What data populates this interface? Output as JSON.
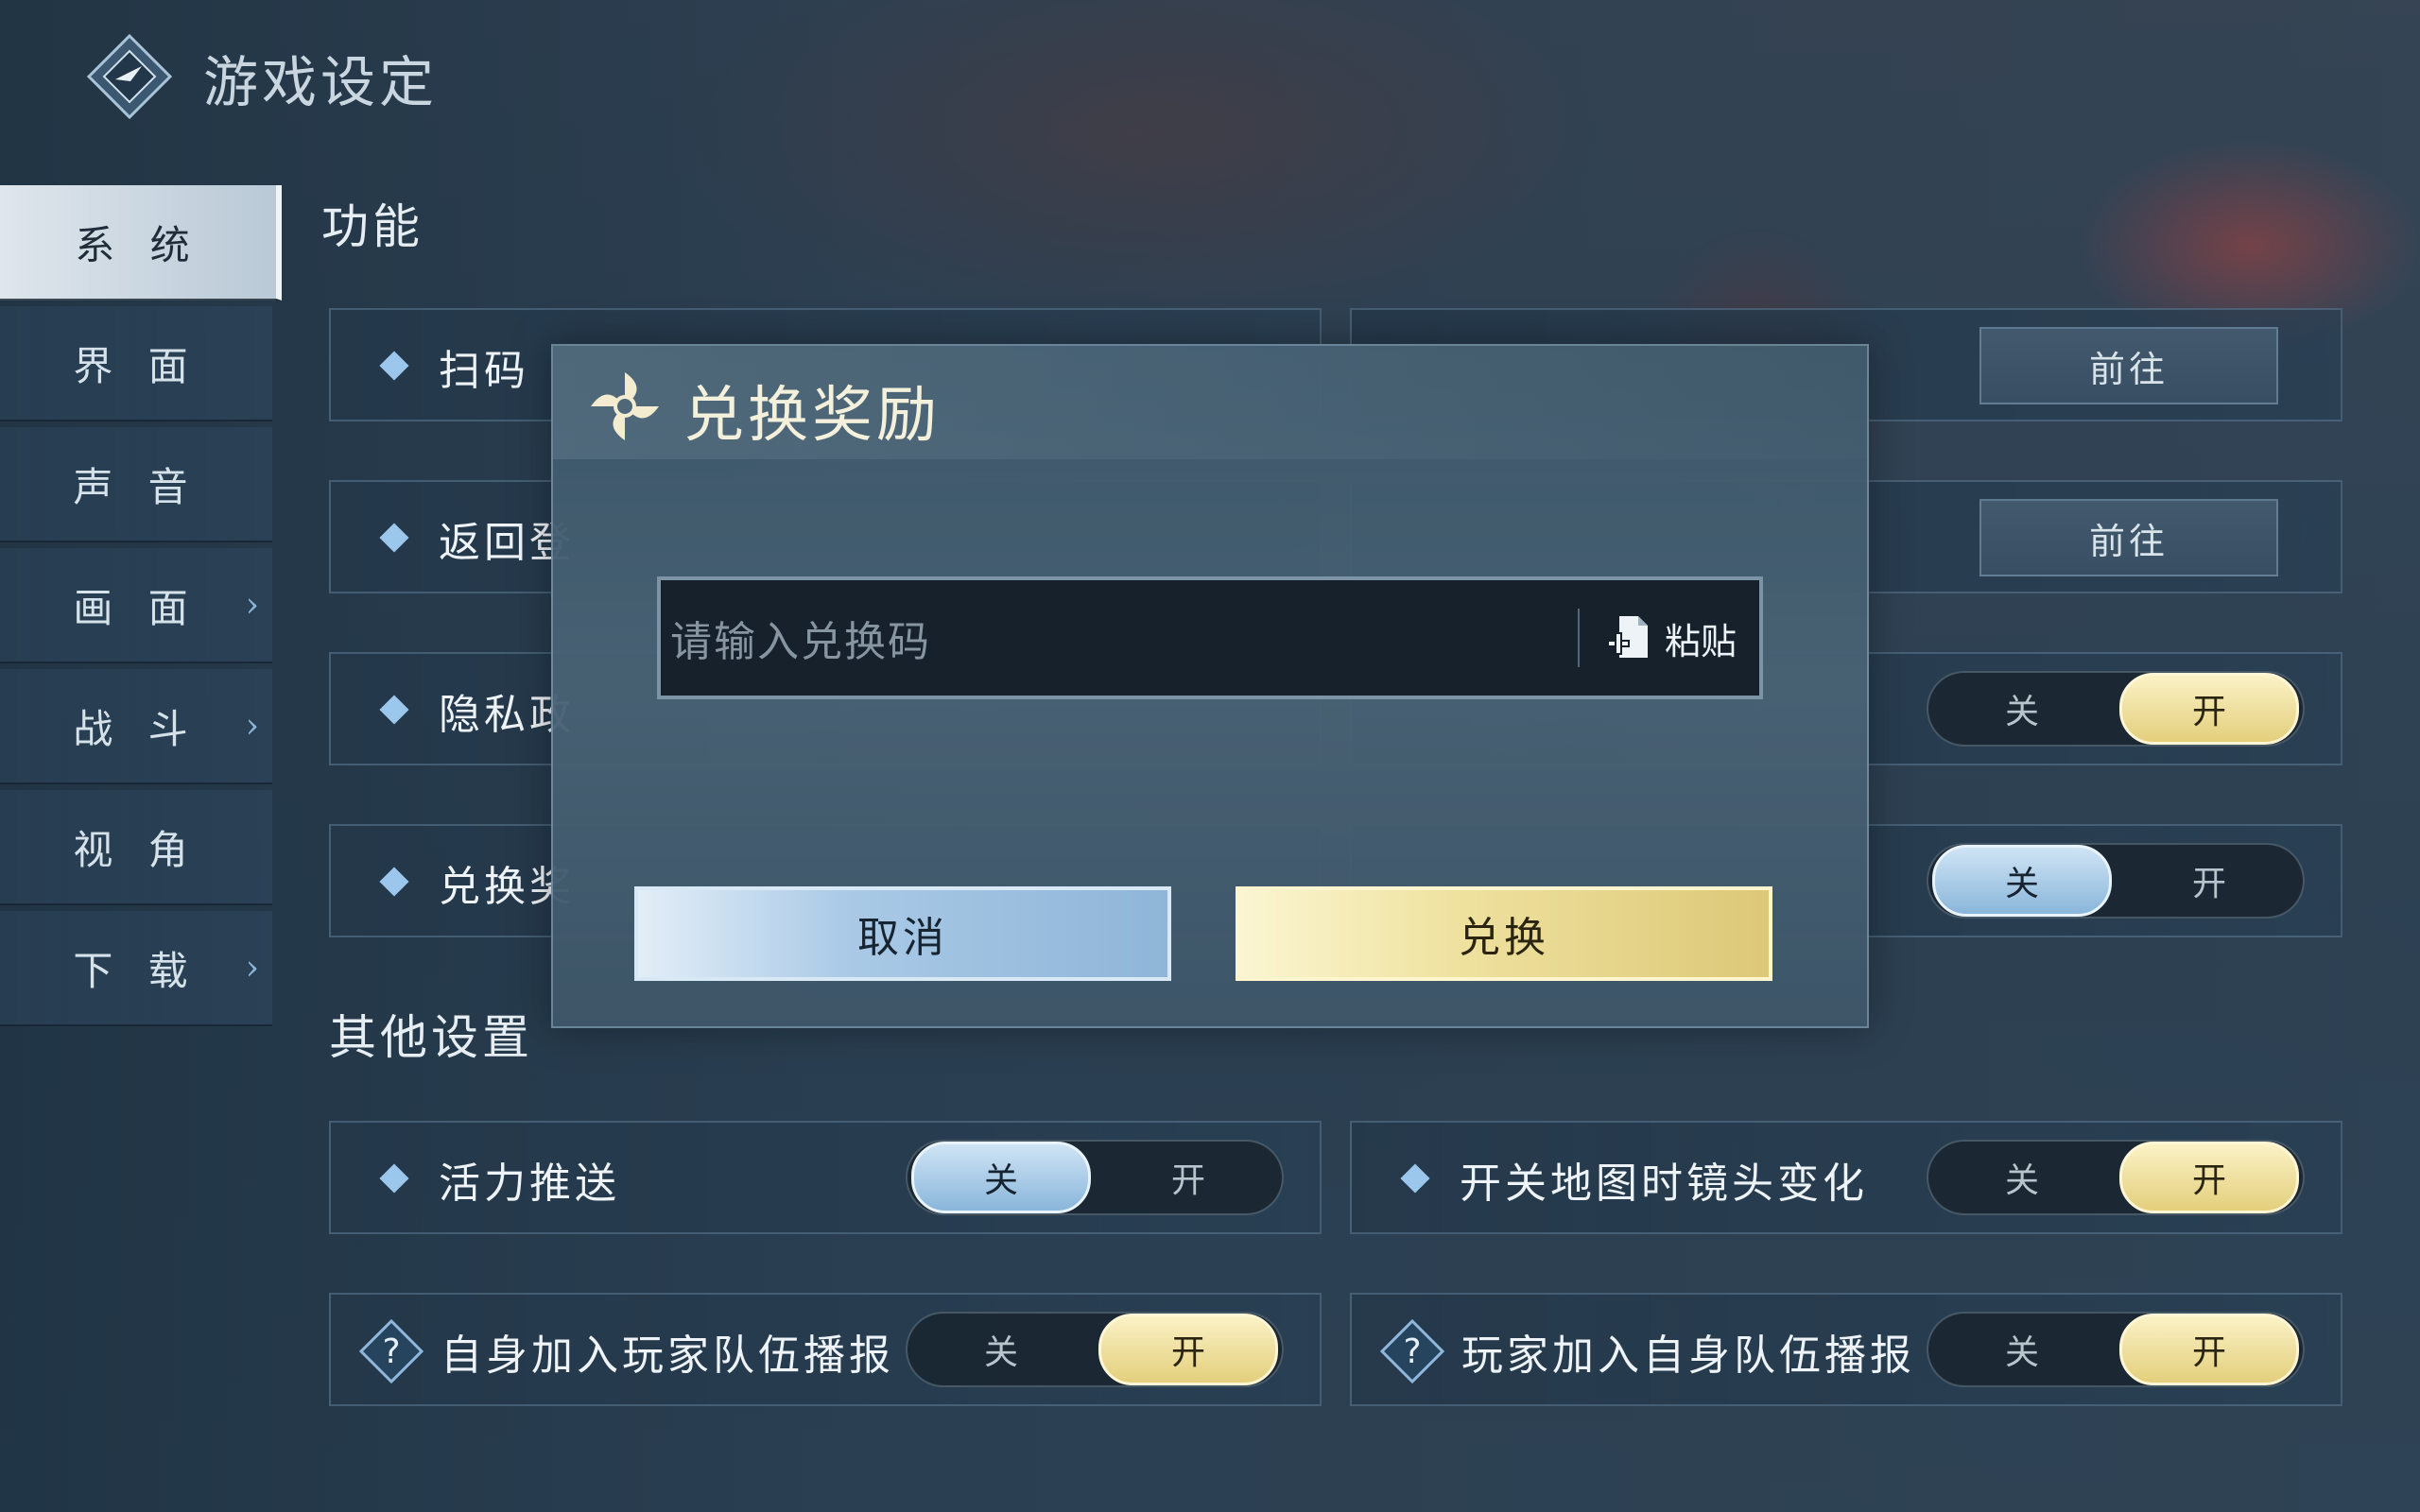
{
  "header": {
    "title": "游戏设定",
    "logo_icon": "diamond-logo-icon"
  },
  "sidebar": {
    "items": [
      {
        "label": "系 统",
        "active": true,
        "has_chevron": false
      },
      {
        "label": "界 面",
        "active": false,
        "has_chevron": false
      },
      {
        "label": "声 音",
        "active": false,
        "has_chevron": false
      },
      {
        "label": "画 面",
        "active": false,
        "has_chevron": true
      },
      {
        "label": "战 斗",
        "active": false,
        "has_chevron": true
      },
      {
        "label": "视 角",
        "active": false,
        "has_chevron": false
      },
      {
        "label": "下 载",
        "active": false,
        "has_chevron": true
      }
    ],
    "chevron": "›"
  },
  "sections": {
    "features": {
      "title": "功能",
      "rows": [
        {
          "label": "扫码"
        },
        {
          "label": "返回登"
        },
        {
          "label": "隐私政"
        },
        {
          "label": "兑换奖"
        }
      ],
      "right_rows": [
        {
          "type": "button",
          "label": "前往"
        },
        {
          "type": "button",
          "label": "前往"
        },
        {
          "type": "toggle",
          "off": "关",
          "on": "开",
          "value": "on"
        },
        {
          "type": "toggle",
          "off": "关",
          "on": "开",
          "value": "off"
        }
      ]
    },
    "other": {
      "title": "其他设置",
      "rows": [
        {
          "label": "活力推送",
          "icon": "diamond",
          "off": "关",
          "on": "开",
          "value": "off"
        },
        {
          "label": "开关地图时镜头变化",
          "icon": "diamond",
          "off": "关",
          "on": "开",
          "value": "on"
        },
        {
          "label": "自身加入玩家队伍播报",
          "icon": "question",
          "off": "关",
          "on": "开",
          "value": "on"
        },
        {
          "label": "玩家加入自身队伍播报",
          "icon": "question",
          "off": "关",
          "on": "开",
          "value": "on"
        }
      ]
    }
  },
  "modal": {
    "title": "兑换奖励",
    "input_placeholder": "请输入兑换码",
    "paste_label": "粘贴",
    "cancel_label": "取消",
    "confirm_label": "兑换"
  },
  "colors": {
    "accent_gold": "#e3cf7c",
    "accent_blue": "#8ab6da",
    "panel": "#2a4256"
  }
}
